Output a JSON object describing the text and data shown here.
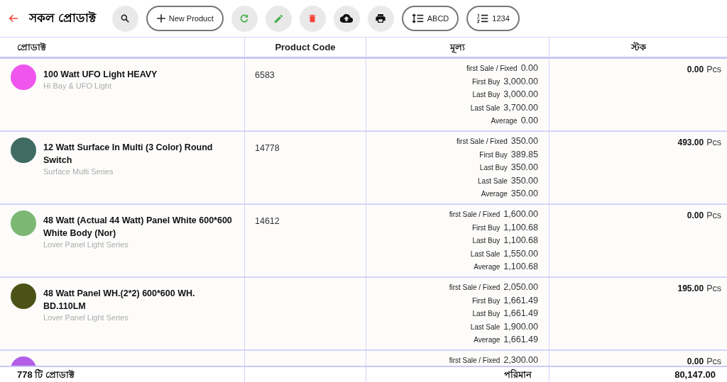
{
  "header": {
    "title": "সকল প্রোডাক্ট",
    "toolbar": [
      {
        "kind": "search"
      },
      {
        "kind": "add",
        "label": "New Product"
      },
      {
        "kind": "refresh"
      },
      {
        "kind": "edit"
      },
      {
        "kind": "delete"
      },
      {
        "kind": "upload"
      },
      {
        "kind": "print"
      },
      {
        "kind": "sort-height",
        "label": "ABCD"
      },
      {
        "kind": "sort-list",
        "label": "1234"
      }
    ]
  },
  "table": {
    "columns": [
      "প্রোডাক্ট",
      "Product Code",
      "মূল্য",
      "স্টক"
    ],
    "rows": [
      {
        "name": "100 Watt UFO Light HEAVY",
        "category": "Hi Bay & UFO Light",
        "code": "6583",
        "color": "#f055ee",
        "prices": [
          {
            "label": "first Sale / Fixed",
            "value": "0.00"
          },
          {
            "label": "First Buy",
            "value": "3,000.00"
          },
          {
            "label": "Last Buy",
            "value": "3,000.00"
          },
          {
            "label": "Last Sale",
            "value": "3,700.00"
          },
          {
            "label": "Average",
            "value": "0.00"
          }
        ],
        "stock": "0.00",
        "unit": "Pcs"
      },
      {
        "name": "12 Watt Surface In Multi (3 Color) Round Switch",
        "category": "Surface Multi Series",
        "code": "14778",
        "color": "#3f6b62",
        "prices": [
          {
            "label": "first Sale / Fixed",
            "value": "350.00"
          },
          {
            "label": "First Buy",
            "value": "389.85"
          },
          {
            "label": "Last Buy",
            "value": "350.00"
          },
          {
            "label": "Last Sale",
            "value": "350.00"
          },
          {
            "label": "Average",
            "value": "350.00"
          }
        ],
        "stock": "493.00",
        "unit": "Pcs"
      },
      {
        "name": "48 Watt (Actual 44 Watt) Panel White 600*600 White Body (Nor)",
        "category": "Lover Panel Light Series",
        "code": "14612",
        "color": "#7cb874",
        "prices": [
          {
            "label": "first Sale / Fixed",
            "value": "1,600.00"
          },
          {
            "label": "First Buy",
            "value": "1,100.68"
          },
          {
            "label": "Last Buy",
            "value": "1,100.68"
          },
          {
            "label": "Last Sale",
            "value": "1,550.00"
          },
          {
            "label": "Average",
            "value": "1,100.68"
          }
        ],
        "stock": "0.00",
        "unit": "Pcs"
      },
      {
        "name": "48 Watt Panel WH.(2*2) 600*600 WH. BD.110LM",
        "category": "Lover Panel Light Series",
        "color": "#4a5217",
        "prices": [
          {
            "label": "first Sale / Fixed",
            "value": "2,050.00"
          },
          {
            "label": "First Buy",
            "value": "1,661.49"
          },
          {
            "label": "Last Buy",
            "value": "1,661.49"
          },
          {
            "label": "Last Sale",
            "value": "1,900.00"
          },
          {
            "label": "Average",
            "value": "1,661.49"
          }
        ],
        "stock": "195.00",
        "unit": "Pcs"
      },
      {
        "color": "#b45ee8",
        "prices": [
          {
            "label": "first Sale / Fixed",
            "value": "2,300.00"
          }
        ],
        "stock": "0.00",
        "unit": "Pcs"
      }
    ]
  },
  "footer": {
    "count": "778 টি প্রোডাক্ট",
    "total_label": "পরিমান",
    "total": "80,147.00"
  }
}
